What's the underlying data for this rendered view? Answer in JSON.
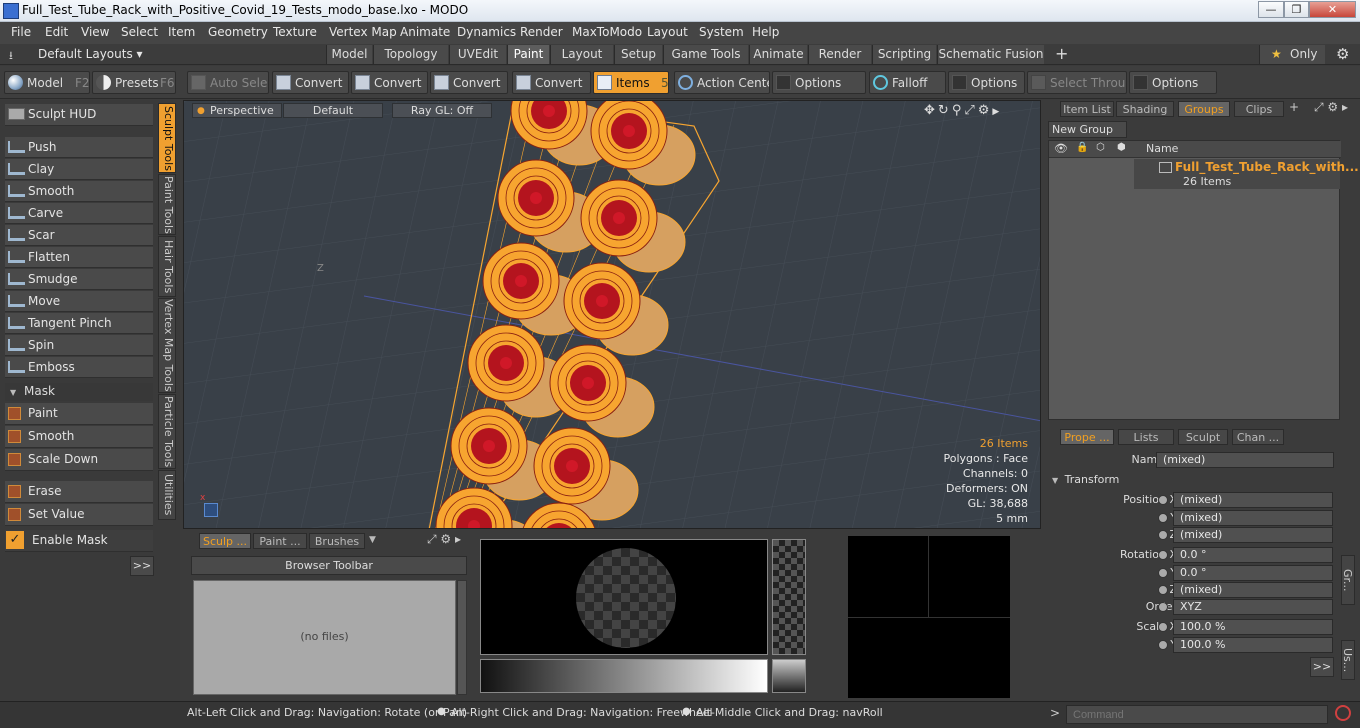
{
  "window": {
    "title": "Full_Test_Tube_Rack_with_Positive_Covid_19_Tests_modo_base.lxo - MODO",
    "min": "—",
    "max": "❐",
    "close": "✕"
  },
  "menu": [
    "File",
    "Edit",
    "View",
    "Select",
    "Item",
    "Geometry",
    "Texture",
    "Vertex Map",
    "Animate",
    "Dynamics",
    "Render",
    "MaxToModo",
    "Layout",
    "System",
    "Help"
  ],
  "layouts": {
    "label": "Default Layouts ▾",
    "tabs": [
      "Model",
      "Topology",
      "UVEdit",
      "Paint",
      "Layout",
      "Setup",
      "Game Tools",
      "Animate",
      "Render",
      "Scripting",
      "Schematic Fusion"
    ],
    "active": "Paint",
    "add": "+",
    "only": "Only"
  },
  "toolbar": {
    "model": "Model",
    "model_key": "F2",
    "presets": "Presets",
    "presets_key": "F6",
    "auto_select": "Auto Select",
    "convert": "Convert",
    "items": "Items",
    "items_key": "5",
    "action_center": "Action Center",
    "options": "Options",
    "falloff": "Falloff",
    "select_through": "Select Through"
  },
  "left": {
    "sculpt_hud": "Sculpt HUD",
    "tools": [
      "Push",
      "Clay",
      "Smooth",
      "Carve",
      "Scar",
      "Flatten",
      "Smudge",
      "Move",
      "Tangent Pinch",
      "Spin",
      "Emboss"
    ],
    "mask_header": "Mask",
    "mask_tools": [
      "Paint",
      "Smooth",
      "Scale Down"
    ],
    "erase": "Erase",
    "set_value": "Set Value",
    "enable_mask": "Enable Mask",
    "expand": ">>",
    "vtabs": [
      "Sculpt Tools",
      "Paint Tools",
      "Hair Tools",
      "Vertex Map Tools",
      "Particle Tools",
      "Utilities"
    ]
  },
  "viewport": {
    "perspective": "Perspective",
    "default": "Default",
    "raygl": "Ray GL: Off",
    "items": "26 Items",
    "polygons": "Polygons : Face",
    "channels": "Channels: 0",
    "deformers": "Deformers: ON",
    "gl": "GL: 38,688",
    "scale": "5 mm",
    "axis_z": "Z"
  },
  "bottom": {
    "tabs": [
      "Sculp ...",
      "Paint ...",
      "Brushes"
    ],
    "browser_toolbar": "Browser Toolbar",
    "no_files": "(no files)"
  },
  "right": {
    "top_tabs": [
      "Item List",
      "Shading",
      "Groups",
      "Clips"
    ],
    "active_top": "Groups",
    "new_group": "New Group",
    "col_name": "Name",
    "group_name": "Full_Test_Tube_Rack_with...",
    "group_count": "26 Items",
    "prop_tabs": [
      "Prope ...",
      "Lists",
      "Sculpt",
      "Chan ..."
    ],
    "active_prop": "Prope ...",
    "name_label": "Name",
    "name_value": "(mixed)",
    "transform": "Transform",
    "rows": [
      {
        "label": "Position X",
        "value": "(mixed)"
      },
      {
        "label": "Y",
        "value": "(mixed)"
      },
      {
        "label": "Z",
        "value": "(mixed)"
      },
      {
        "label": "Rotation X",
        "value": "0.0 °"
      },
      {
        "label": "Y",
        "value": "0.0 °"
      },
      {
        "label": "Z",
        "value": "(mixed)"
      },
      {
        "label": "Order",
        "value": "XYZ"
      },
      {
        "label": "Scale X",
        "value": "100.0 %"
      },
      {
        "label": "Y",
        "value": "100.0 %"
      }
    ],
    "side_tabs": [
      "Gr...",
      "Us..."
    ]
  },
  "status": {
    "hint1": "Alt-Left Click and Drag: Navigation: Rotate (or Pan)",
    "hint2": "Alt-Right Click and Drag: Navigation: Freewheel",
    "hint3": "Alt-Middle Click and Drag: navRoll",
    "command_placeholder": "Command"
  },
  "colors": {
    "accent": "#f0a030",
    "mesh_orange": "#f7a530",
    "mesh_red": "#b4141e",
    "viewport_bg": "#394048"
  }
}
